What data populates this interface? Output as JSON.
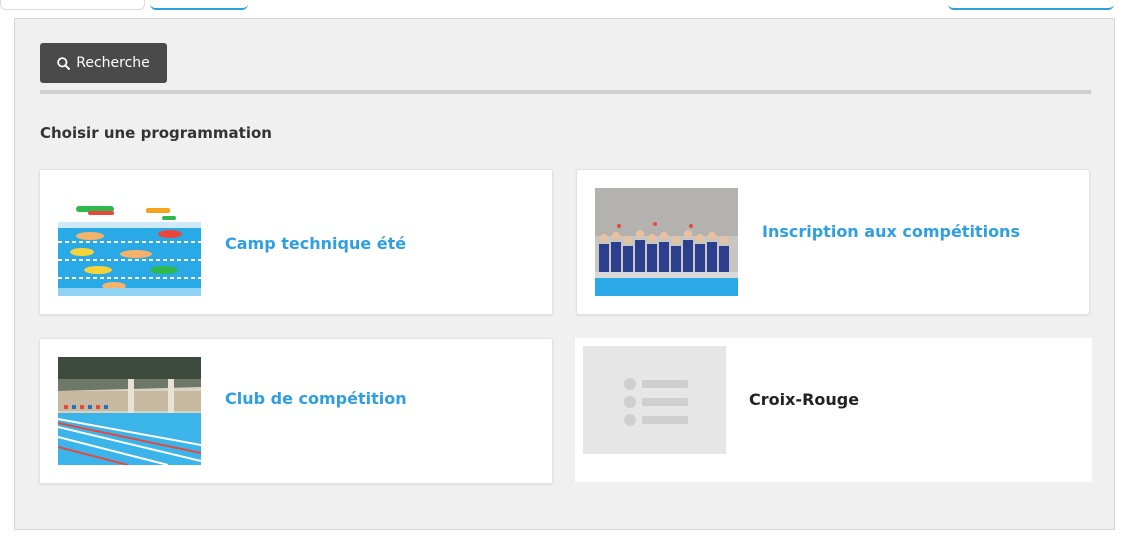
{
  "toolbar": {
    "search_label": "Recherche",
    "search_icon": "search-icon"
  },
  "section": {
    "title": "Choisir une programmation"
  },
  "programs": [
    {
      "title": "Camp technique été",
      "image": "swimmers-pool-image"
    },
    {
      "title": "Inscription aux compétitions",
      "image": "swim-team-photo"
    },
    {
      "title": "Club de compétition",
      "image": "indoor-pool-image"
    },
    {
      "title": "Croix-Rouge",
      "image": "list-placeholder-icon"
    }
  ],
  "colors": {
    "accent": "#2e9fe0",
    "button_bg": "#4a4a4a",
    "panel_bg": "#f0f0f0"
  }
}
